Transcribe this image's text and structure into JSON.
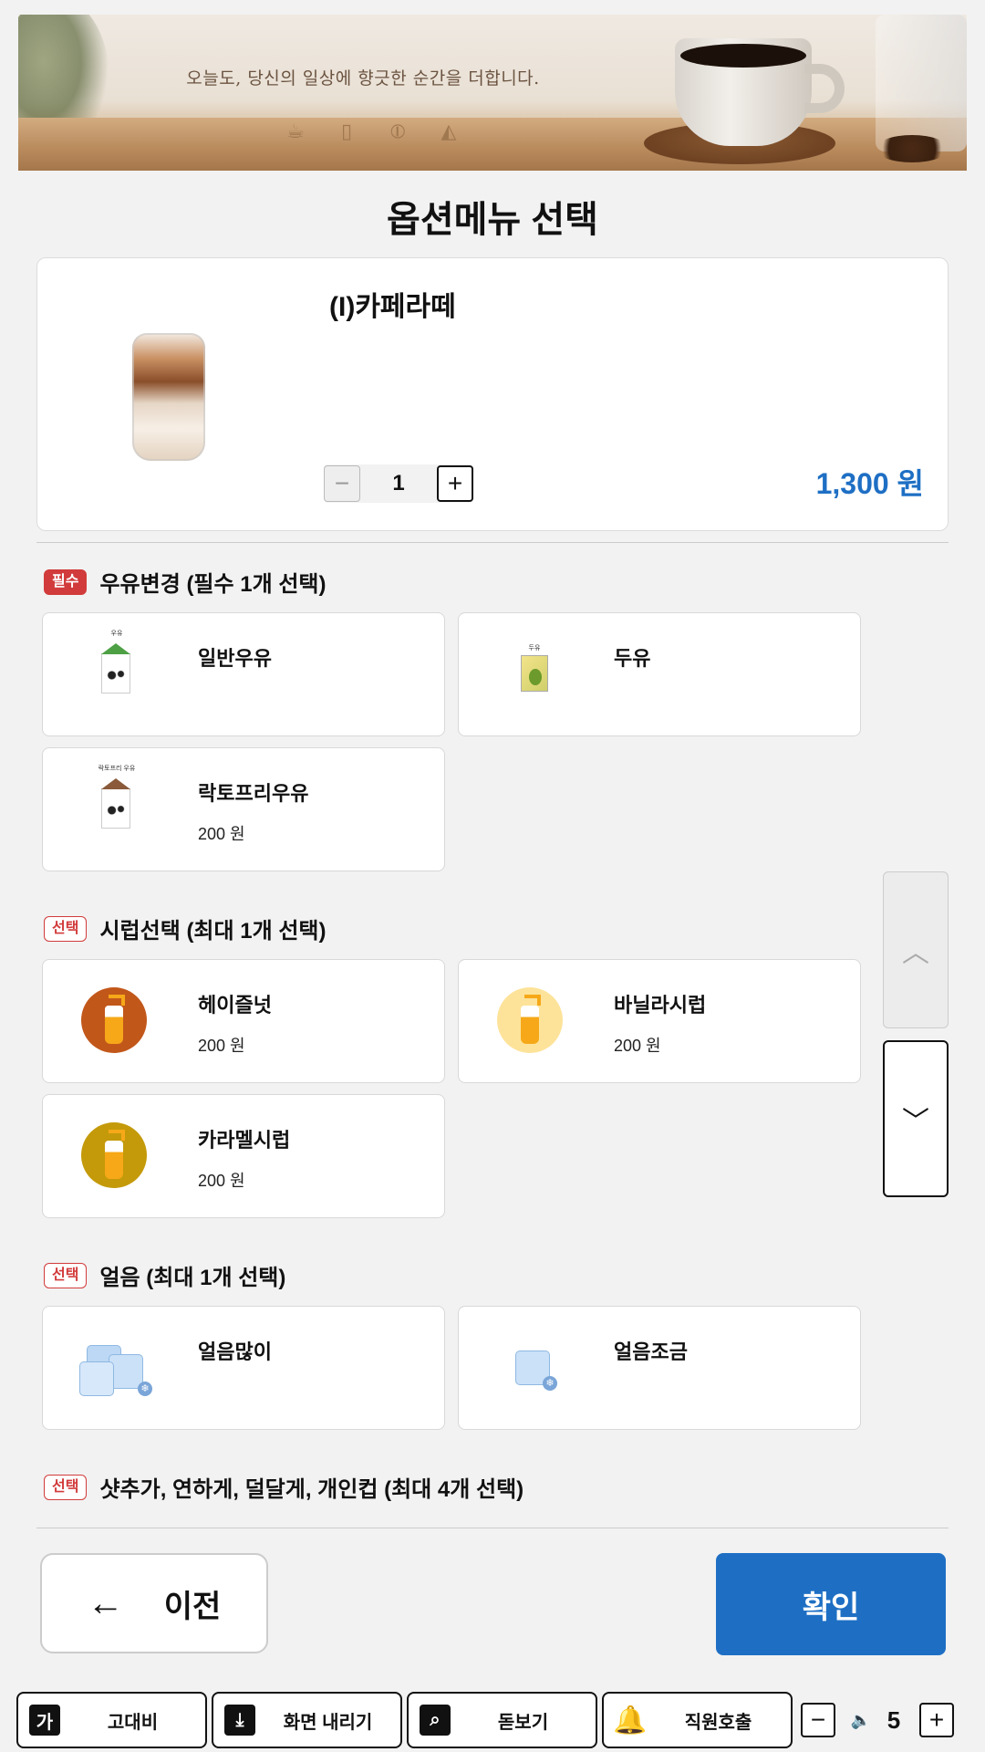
{
  "banner": {
    "tagline": "오늘도, 당신의 일상에 향긋한 순간을 더합니다.",
    "icons": [
      "coffee-cup-icon",
      "takeout-cup-icon",
      "coffee-bean-icon",
      "cake-icon"
    ]
  },
  "page_title": "옵션메뉴 선택",
  "product": {
    "name": "(I)카페라떼",
    "quantity": "1",
    "price": "1,300 원"
  },
  "sections": [
    {
      "badge": "필수",
      "title": "우유변경  (필수 1개 선택)",
      "options": [
        {
          "label": "일반우유",
          "price": ""
        },
        {
          "label": "두유",
          "price": ""
        },
        {
          "label": "락토프리우유",
          "price": "200 원"
        }
      ]
    },
    {
      "badge": "선택",
      "title": "시럽선택  (최대 1개 선택)",
      "options": [
        {
          "label": "헤이즐넛",
          "price": "200 원"
        },
        {
          "label": "바닐라시럽",
          "price": "200 원"
        },
        {
          "label": "카라멜시럽",
          "price": "200 원"
        }
      ]
    },
    {
      "badge": "선택",
      "title": "얼음  (최대 1개 선택)",
      "options": [
        {
          "label": "얼음많이",
          "price": ""
        },
        {
          "label": "얼음조금",
          "price": ""
        }
      ]
    },
    {
      "badge": "선택",
      "title": "샷추가, 연하게, 덜달게, 개인컵  (최대 4개 선택)",
      "options": []
    }
  ],
  "thumb_labels": {
    "milk": "우유",
    "soy": "두유",
    "lactofree": "락토프리 우유"
  },
  "footer": {
    "prev_label": "이전",
    "ok_label": "확인"
  },
  "accessibility": {
    "contrast_label": "고대비",
    "contrast_icon_text": "가",
    "lower_label": "화면 내리기",
    "magnifier_label": "돋보기",
    "call_staff_label": "직원호출",
    "volume": "5"
  },
  "colors": {
    "accent_blue": "#1e6fc4",
    "required_red": "#d23b3b",
    "hazelnut": "#c2571a",
    "vanilla": "#fde39a",
    "caramel": "#c49a0a"
  }
}
